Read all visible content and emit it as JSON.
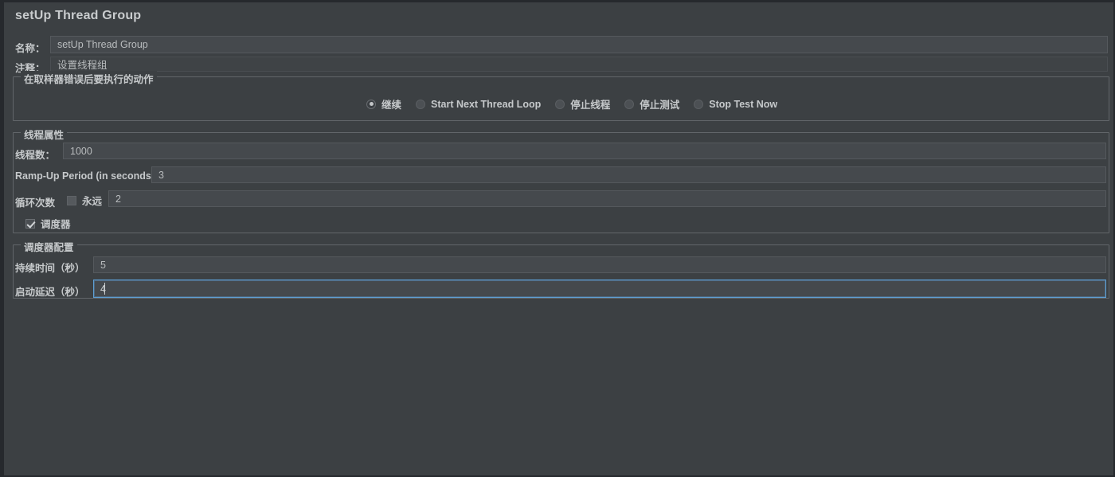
{
  "window": {
    "title": "setUp Thread Group"
  },
  "name_row": {
    "label": "名称：",
    "value": "setUp Thread Group"
  },
  "comment_row": {
    "label": "注释：",
    "value": "设置线程组"
  },
  "error_action": {
    "group_title": "在取样器错误后要执行的动作",
    "selected": "继续",
    "options": [
      {
        "label": "继续",
        "selected": true
      },
      {
        "label": "Start Next Thread Loop",
        "selected": false
      },
      {
        "label": "停止线程",
        "selected": false
      },
      {
        "label": "停止测试",
        "selected": false
      },
      {
        "label": "Stop Test Now",
        "selected": false
      }
    ]
  },
  "thread_properties": {
    "group_title": "线程属性",
    "num_threads": {
      "label": "线程数：",
      "value": "1000"
    },
    "ramp_up": {
      "label": "Ramp-Up Period (in seconds):",
      "value": "3"
    },
    "loop_count": {
      "label": "循环次数",
      "forever_label": "永远",
      "forever_checked": false,
      "value": "2"
    },
    "scheduler_toggle": {
      "label": "调度器",
      "checked": true
    }
  },
  "scheduler_config": {
    "group_title": "调度器配置",
    "duration": {
      "label": "持续时间（秒）",
      "value": "5"
    },
    "startup_delay": {
      "label": "启动延迟（秒）",
      "value": "4",
      "focused": true
    }
  },
  "colors": {
    "panel_bg": "#3c4043",
    "field_bg": "#45494d",
    "text": "#c6c9cb",
    "focus_border": "#5e9fd4",
    "group_border": "#62666a"
  }
}
